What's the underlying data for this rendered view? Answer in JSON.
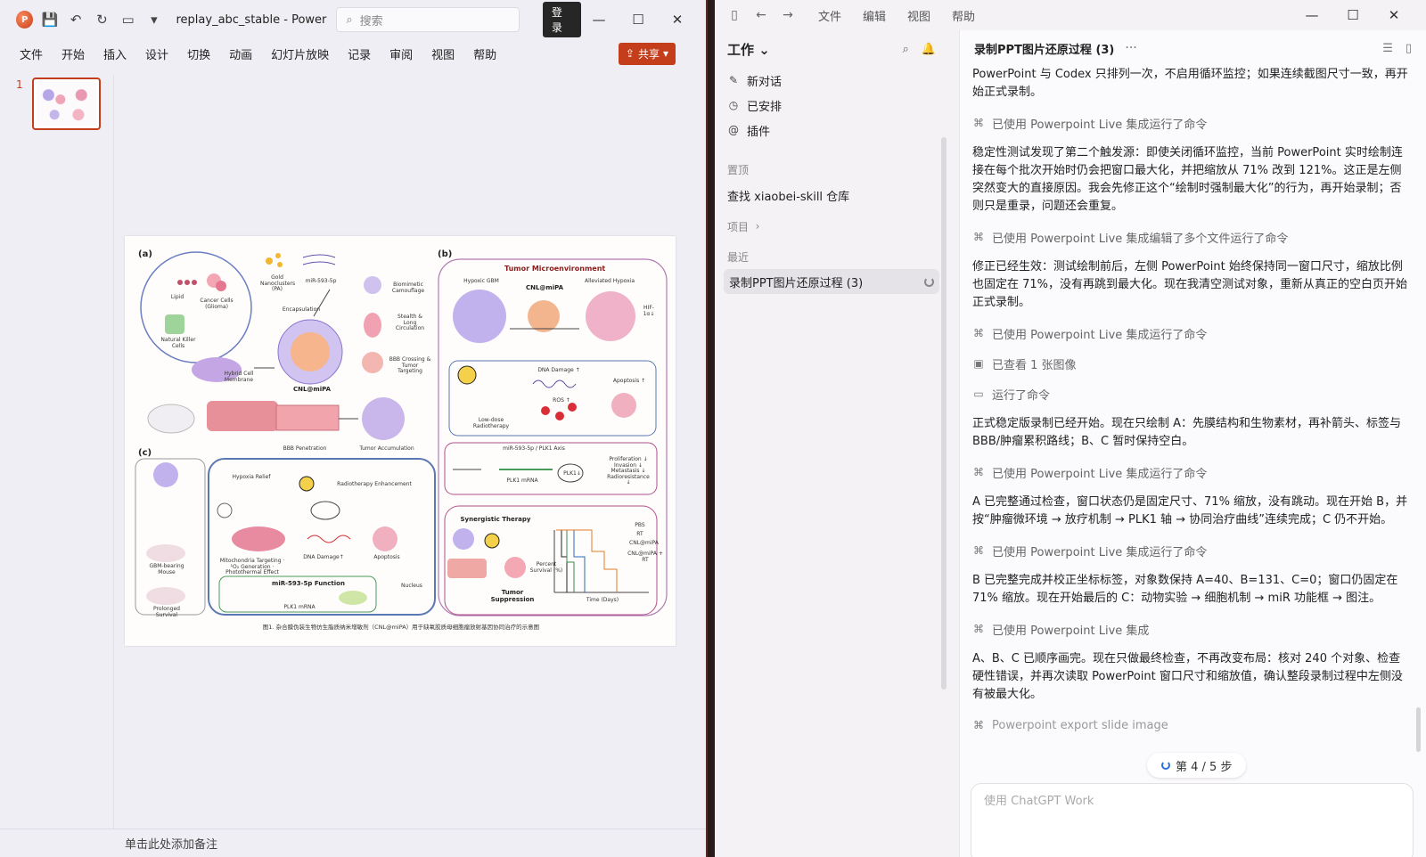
{
  "ppt": {
    "title": "replay_abc_stable  -  PowerPo...",
    "search_placeholder": "搜索",
    "login_label": "登录",
    "share_label": "共享",
    "menu": [
      "文件",
      "开始",
      "插入",
      "设计",
      "切换",
      "动画",
      "幻灯片放映",
      "记录",
      "审阅",
      "视图",
      "帮助"
    ],
    "slide_number": "1",
    "notes_placeholder": "单击此处添加备注",
    "figure": {
      "label_a": "(a)",
      "label_b": "(b)",
      "label_c": "(c)",
      "lipid": "Lipid",
      "cancer_cells": "Cancer Cells (Glioma)",
      "gold": "Gold Nanoclusters (PA)",
      "mir": "miR-593-5p",
      "encapsulation": "Encapsulation",
      "nk_cells": "Natural Killer Cells",
      "hybrid": "Hybrid Cell Membrane",
      "cnl": "CNL@miPA",
      "biomimetic": "Biomimetic Camouflage",
      "stealth": "Stealth & Long Circulation",
      "bbb_cross": "BBB Crossing & Tumor Targeting",
      "bbb_pen": "BBB Penetration",
      "tumor_acc": "Tumor Accumulation",
      "tme_title": "Tumor Microenvironment",
      "hypoxic": "Hypoxic GBM",
      "cnl_b": "CNL@miPA",
      "alleviated": "Alleviated Hypoxia",
      "hif": "HIF-1α↓",
      "dna_damage": "DNA Damage ↑",
      "ros": "ROS ↑",
      "apoptosis": "Apoptosis ↑",
      "low_dose": "Low-dose Radiotherapy",
      "axis": "miR-593-5p / PLK1 Axis",
      "plk1_mrna": "PLK1 mRNA",
      "plk1": "PLK1↓",
      "prolif": "Proliferation ↓ Invasion ↓ Metastasis ↓ Radioresistance ↓",
      "synergistic": "Synergistic Therapy",
      "tumor_supp": "Tumor Suppression",
      "percent_survival": "Percent Survival (%)",
      "time_days": "Time (Days)",
      "legend": [
        "PBS",
        "RT",
        "CNL@miPA",
        "CNL@miPA + RT"
      ],
      "hypoxia_relief": "Hypoxia Relief",
      "rt_enh": "Radiotherapy Enhancement",
      "mito": "Mitochondria Targeting · ¹O₂ Generation · Photothermal Effect",
      "dna_dmg_c": "DNA Damage↑",
      "apoptosis_c": "Apoptosis",
      "mir_function": "miR-593-5p Function",
      "plk1_mrna_c": "PLK1 mRNA",
      "nucleus": "Nucleus",
      "gbm_mouse": "GBM-bearing Mouse",
      "prolonged": "Prolonged Survival",
      "caption": "图1. 杂合膜伪装生物仿生脂质纳米增敏剂（CNL@miPA）用于缺氧胶质母细胞瘤放射基因协同治疗的示意图"
    }
  },
  "codex": {
    "menu": [
      "文件",
      "编辑",
      "视图",
      "帮助"
    ],
    "workspace": "工作",
    "sidebar_items": [
      "新对话",
      "已安排",
      "插件"
    ],
    "pinned_header": "置顶",
    "pinned_item": "查找 xiaobei-skill 仓库",
    "projects_header": "项目",
    "recent_header": "最近",
    "recent_item": "录制PPT图片还原过程 (3)",
    "chat_title": "录制PPT图片还原过程 (3)",
    "messages": [
      {
        "kind": "text",
        "text": "PowerPoint 与 Codex 只排列一次，不启用循环监控；如果连续截图尺寸一致，再开始正式录制。"
      },
      {
        "kind": "tool",
        "icon": "⌘",
        "text": "已使用 Powerpoint Live 集成运行了命令"
      },
      {
        "kind": "text",
        "text": "稳定性测试发现了第二个触发源：即使关闭循环监控，当前 PowerPoint 实时绘制连接在每个批次开始时仍会把窗口最大化，并把缩放从 71% 改到 121%。这正是左侧突然变大的直接原因。我会先修正这个“绘制时强制最大化”的行为，再开始录制；否则只是重录，问题还会重复。"
      },
      {
        "kind": "tool",
        "icon": "⌘",
        "text": "已使用 Powerpoint Live 集成编辑了多个文件运行了命令"
      },
      {
        "kind": "text",
        "text": "修正已经生效：测试绘制前后，左侧 PowerPoint 始终保持同一窗口尺寸，缩放比例也固定在 71%，没有再跳到最大化。现在我清空测试对象，重新从真正的空白页开始正式录制。"
      },
      {
        "kind": "tool",
        "icon": "⌘",
        "text": "已使用 Powerpoint Live 集成运行了命令"
      },
      {
        "kind": "tool",
        "icon": "▣",
        "text": "已查看 1 张图像"
      },
      {
        "kind": "tool",
        "icon": "▭",
        "text": "运行了命令"
      },
      {
        "kind": "text",
        "text": "正式稳定版录制已经开始。现在只绘制 A：先膜结构和生物素材，再补箭头、标签与 BBB/肿瘤累积路线；B、C 暂时保持空白。"
      },
      {
        "kind": "tool",
        "icon": "⌘",
        "text": "已使用 Powerpoint Live 集成运行了命令"
      },
      {
        "kind": "text",
        "text": "A 已完整通过检查，窗口状态仍是固定尺寸、71% 缩放，没有跳动。现在开始 B，并按“肿瘤微环境 → 放疗机制 → PLK1 轴 → 协同治疗曲线”连续完成；C 仍不开始。"
      },
      {
        "kind": "tool",
        "icon": "⌘",
        "text": "已使用 Powerpoint Live 集成运行了命令"
      },
      {
        "kind": "text",
        "text": "B 已完整完成并校正坐标标签，对象数保持 A=40、B=131、C=0；窗口仍固定在 71% 缩放。现在开始最后的 C：动物实验 → 细胞机制 → miR 功能框 → 图注。"
      },
      {
        "kind": "tool",
        "icon": "⌘",
        "text": "已使用 Powerpoint Live 集成"
      },
      {
        "kind": "text",
        "text": "A、B、C 已顺序画完。现在只做最终检查，不再改变布局：核对 240 个对象、检查硬性错误，并再次读取 PowerPoint 窗口尺寸和缩放值，确认整段录制过程中左侧没有被最大化。"
      },
      {
        "kind": "tool_faded",
        "icon": "⌘",
        "text": "Powerpoint export slide image"
      }
    ],
    "progress": "第 4 / 5 步",
    "composer_placeholder": "使用 ChatGPT Work"
  },
  "colors": {
    "ppt_accent": "#c43e1c",
    "progress_accent": "#2c6fe0"
  }
}
